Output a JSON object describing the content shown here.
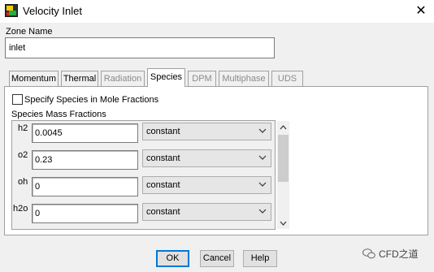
{
  "window": {
    "title": "Velocity Inlet",
    "close_glyph": "✕"
  },
  "zone": {
    "label": "Zone Name",
    "value": "inlet"
  },
  "tabs": [
    {
      "label": "Momentum",
      "state": "normal"
    },
    {
      "label": "Thermal",
      "state": "normal"
    },
    {
      "label": "Radiation",
      "state": "disabled"
    },
    {
      "label": "Species",
      "state": "active"
    },
    {
      "label": "DPM",
      "state": "disabled"
    },
    {
      "label": "Multiphase",
      "state": "disabled"
    },
    {
      "label": "UDS",
      "state": "disabled"
    }
  ],
  "species": {
    "mole_fraction_label": "Specify Species in Mole Fractions",
    "mole_fraction_checked": false,
    "section_label": "Species Mass Fractions",
    "rows": [
      {
        "name": "h2",
        "value": "0.0045",
        "method": "constant"
      },
      {
        "name": "o2",
        "value": "0.23",
        "method": "constant"
      },
      {
        "name": "oh",
        "value": "0",
        "method": "constant"
      },
      {
        "name": "h2o",
        "value": "0",
        "method": "constant"
      }
    ]
  },
  "buttons": {
    "ok": "OK",
    "cancel": "Cancel",
    "help": "Help"
  },
  "watermark": {
    "text": "CFD之道",
    "icon": "wechat-icon"
  },
  "colors": {
    "default_button_border": "#0078d7",
    "dialog_bg": "#f0f0f0",
    "disabled_text": "#8a8a8a"
  }
}
